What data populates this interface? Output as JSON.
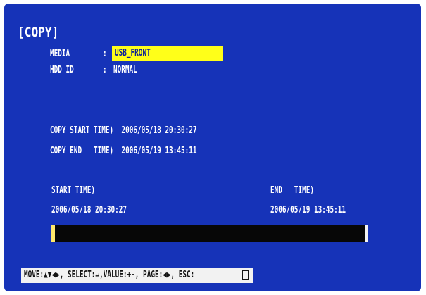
{
  "screen": {
    "title": "[COPY]",
    "media_label": "MEDIA",
    "media_colon": ":",
    "media_value": "USB_FRONT",
    "hdd_label": "HDD ID",
    "hdd_colon": ":",
    "hdd_value": "NORMAL",
    "copy_start_line": "COPY START TIME)  2006/05/18 20:30:27",
    "copy_end_line": "COPY END   TIME)  2006/05/19 13:45:11",
    "start_time_label": "START TIME)",
    "end_time_label": "END   TIME)",
    "start_time_value": "2006/05/18 20:30:27",
    "end_time_value": "2006/05/19 13:45:11",
    "help_text": "MOVE:▲▼◀▶, SELECT:↵,VALUE:+-, PAGE:◀▶, ESC:"
  },
  "colors": {
    "background": "#1633b8",
    "highlight": "#ffff19",
    "timeline": "#070707"
  },
  "icons": {
    "esc": "esc-key-icon"
  }
}
